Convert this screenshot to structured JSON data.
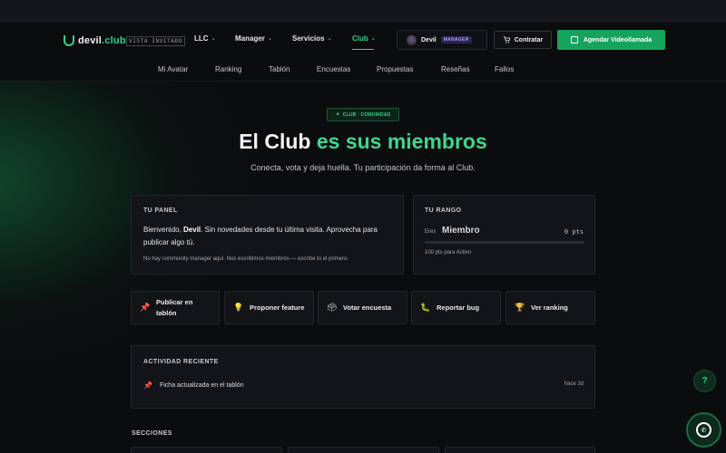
{
  "header": {
    "logo": {
      "prefix": "devil",
      "suffix": ".club"
    },
    "vista_badge": "VISTA INVITADO",
    "nav": [
      {
        "label": "LLC",
        "chevron": true
      },
      {
        "label": "Manager",
        "chevron": true
      },
      {
        "label": "Servicios",
        "chevron": true
      },
      {
        "label": "Club",
        "chevron": true,
        "active": true
      }
    ],
    "user": {
      "name": "Devil",
      "role_badge": "MANAGER"
    },
    "contratar_label": "Contratar",
    "video_label": "Agendar Videollamada"
  },
  "subnav": [
    "Mi Avatar",
    "Ranking",
    "Tablón",
    "Encuestas",
    "Propuestas",
    "Reseñas",
    "Fallos"
  ],
  "hero": {
    "chip": "CLUB · COMUNIDAD",
    "title_white": "El Club ",
    "title_accent": "es sus miembros",
    "subtitle": "Conecta, vota y deja huella. Tu participación da forma al Club."
  },
  "panel": {
    "label": "TU PANEL",
    "welcome_prefix": "Bienvenido, ",
    "welcome_name": "Devil",
    "welcome_rest": ". Sin novedades desde tu última visita. Aprovecha para publicar algo tú.",
    "note": "No hay community manager aquí. Nos escribimos miembros — escribe tú el primero."
  },
  "rank": {
    "label": "TU RANGO",
    "eres": "Eres",
    "name": "Miembro",
    "points": "0 pts",
    "progress": 0,
    "next": "100 pts para Activo"
  },
  "actions": [
    {
      "icon": "pin-icon",
      "glyph": "📌",
      "label": "Publicar en tablón"
    },
    {
      "icon": "bulb-icon",
      "glyph": "💡",
      "label": "Proponer feature"
    },
    {
      "icon": "ballot-icon",
      "glyph": "🗳",
      "label": "Votar encuesta"
    },
    {
      "icon": "bug-icon",
      "glyph": "🐛",
      "label": "Reportar bug"
    },
    {
      "icon": "trophy-icon",
      "glyph": "🏆",
      "label": "Ver ranking"
    }
  ],
  "activity": {
    "label": "ACTIVIDAD RECIENTE",
    "items": [
      {
        "icon": "pin-icon",
        "glyph": "📌",
        "text": "Ficha actualizada en el tablón",
        "time": "hace 3d"
      }
    ]
  },
  "sections_label": "SECCIONES",
  "colors": {
    "accent": "#2fd38b",
    "cta": "#16a35c",
    "background": "#0b0c0e"
  }
}
